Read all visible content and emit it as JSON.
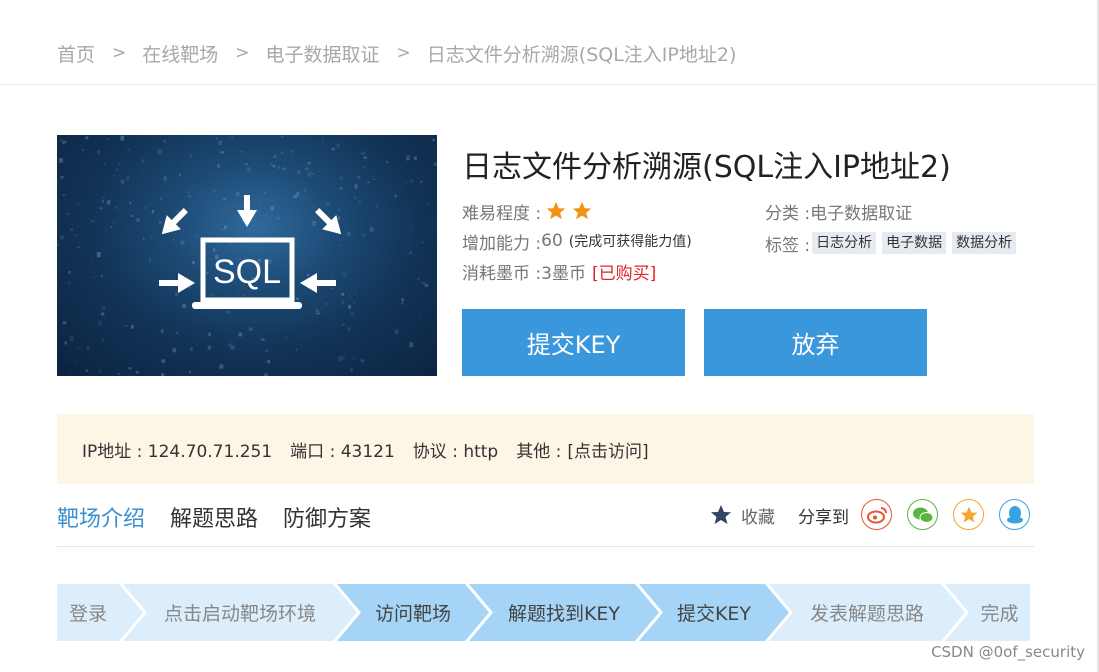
{
  "breadcrumb": [
    "首页",
    "在线靶场",
    "电子数据取证",
    "日志文件分析溯源(SQL注入IP地址2)"
  ],
  "breadcrumb_separator": ">",
  "hero": {
    "image_text": "SQL"
  },
  "title": "日志文件分析溯源(SQL注入IP地址2)",
  "meta": {
    "difficulty_label": "难易程度 : ",
    "difficulty_stars": 2,
    "ability_label": "增加能力 : ",
    "ability_value": "60",
    "ability_note": "(完成可获得能力值)",
    "cost_label": "消耗墨币 : ",
    "cost_value": "3墨币",
    "cost_status": "[已购买]",
    "category_label": "分类 : ",
    "category_value": "电子数据取证",
    "tags_label": "标签 : ",
    "tags": [
      "日志分析",
      "电子数据",
      "数据分析"
    ]
  },
  "buttons": {
    "submit": "提交KEY",
    "give_up": "放弃"
  },
  "ipbar": {
    "ip": "IP地址 : 124.70.71.251",
    "port": "端口 : 43121",
    "protocol": "协议 : http",
    "other_label": "其他 : ",
    "other_link": "[点击访问]"
  },
  "tabs": [
    "靶场介绍",
    "解题思路",
    "防御方案"
  ],
  "active_tab": 0,
  "collect_label": "收藏",
  "share_label": "分享到",
  "share_icons": [
    {
      "name": "weibo-icon",
      "color": "#e8542f"
    },
    {
      "name": "wechat-icon",
      "color": "#5bb43f"
    },
    {
      "name": "qzone-icon",
      "color": "#f4a62a"
    },
    {
      "name": "qq-icon",
      "color": "#38a3e0"
    }
  ],
  "steps": [
    "登录",
    "点击启动靶场环境",
    "访问靶场",
    "解题找到KEY",
    "提交KEY",
    "发表解题思路",
    "完成"
  ],
  "steps_active": [
    2,
    3,
    4
  ],
  "colors": {
    "accent": "#3a97dc",
    "step_light": "#dcedfb",
    "step_active": "#a6d4f7",
    "star": "#f29312",
    "red": "#e2232a"
  },
  "watermark": "CSDN @0of_security"
}
